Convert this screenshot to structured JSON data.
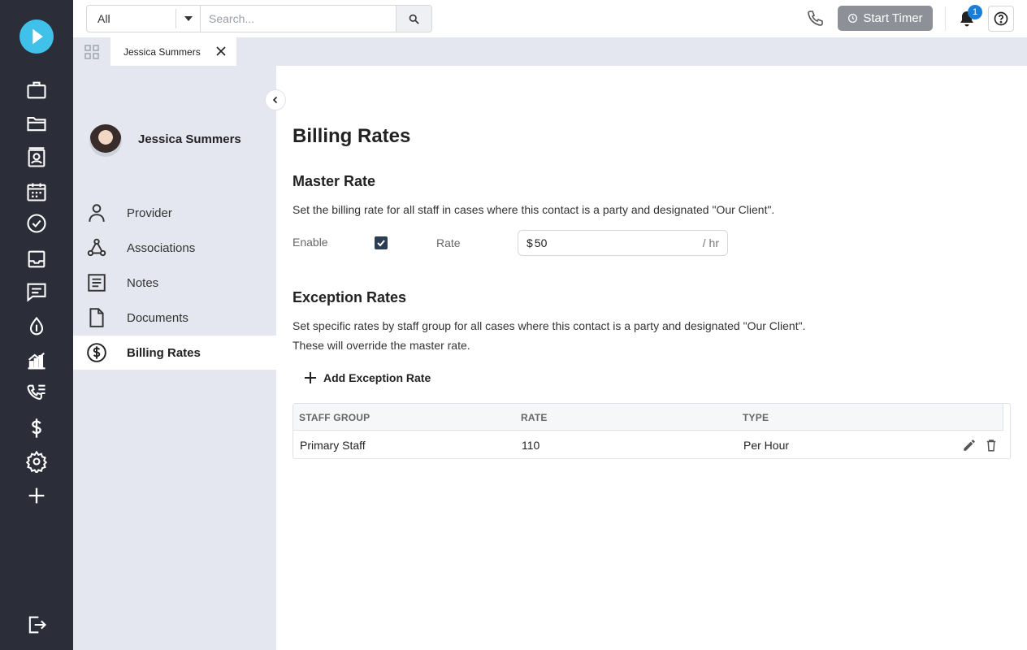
{
  "rail": {
    "icons": [
      "play-icon",
      "briefcase-icon",
      "folder-icon",
      "contacts-icon",
      "calendar-icon",
      "tasks-icon",
      "inbox-icon",
      "messages-icon",
      "trust-icon",
      "reports-icon",
      "call-log-icon",
      "billing-icon",
      "settings-icon",
      "add-icon",
      "logout-icon"
    ]
  },
  "topbar": {
    "search_scope": "All",
    "search_placeholder": "Search...",
    "timer_label": "Start Timer",
    "notification_count": "1"
  },
  "tabs": [
    {
      "label": "Jessica Summers"
    }
  ],
  "contact": {
    "name": "Jessica Summers",
    "menu": [
      {
        "label": "Provider",
        "icon": "person-icon"
      },
      {
        "label": "Associations",
        "icon": "network-icon"
      },
      {
        "label": "Notes",
        "icon": "notes-icon"
      },
      {
        "label": "Documents",
        "icon": "document-icon"
      },
      {
        "label": "Billing Rates",
        "icon": "dollar-circle-icon",
        "active": true
      }
    ]
  },
  "main": {
    "title": "Billing Rates",
    "master": {
      "heading": "Master Rate",
      "description": "Set the billing rate for all staff in cases where this contact is a party and designated \"Our Client\".",
      "enable_label": "Enable",
      "enabled": true,
      "rate_label": "Rate",
      "currency": "$",
      "rate_value": "50",
      "unit": "/ hr"
    },
    "exception": {
      "heading": "Exception Rates",
      "description_1": "Set specific rates by staff group for all cases where this contact is a party and designated \"Our Client\".",
      "description_2": "These will override the master rate.",
      "add_label": "Add Exception Rate",
      "columns": [
        "STAFF GROUP",
        "RATE",
        "TYPE"
      ],
      "rows": [
        {
          "staff_group": "Primary Staff",
          "rate": "110",
          "type": "Per Hour"
        }
      ]
    }
  }
}
